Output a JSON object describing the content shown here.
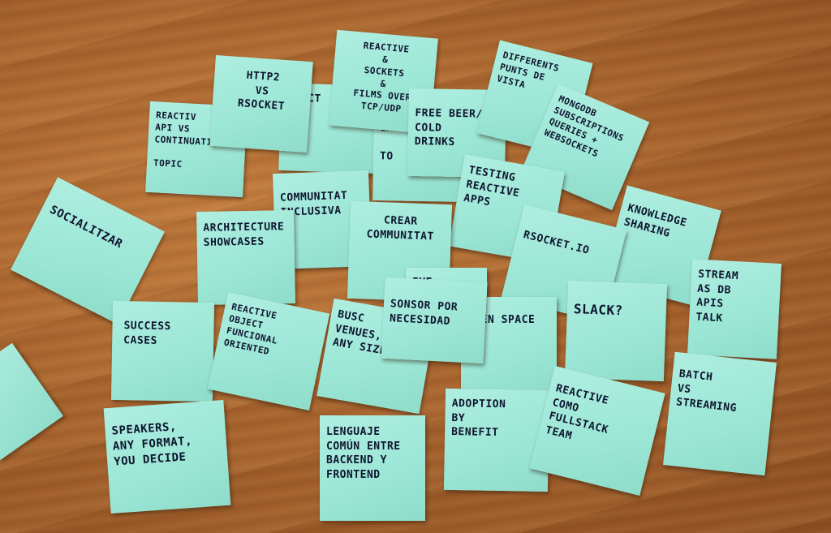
{
  "notes": {
    "socialitzar": "SOCIALITZAR",
    "reactive_api": "REACTIV\nAPI VS\nCONTINUATIONS\n\nTOPIC",
    "http2": "HTTP2\nVS\nRSOCKET",
    "spect": "SPECT",
    "reactive_sockets": "REACTIVE\n&\nSOCKETS\n&\nFILMS OVER\nTCP/UDP",
    "free_beer": "FREE BEER/\nCOLD\nDRINKS",
    "exp_topic": "EXO\n\nTO",
    "different_points": "DIFFERENTS\nPUNTS DE\nVISTA",
    "mongodb": "MONGODB\nSUBSCRIPTIONS\nQUERIES +\nWEBSOCKETS",
    "testing_reactive": "TESTING\nREACTIVE\nAPPS",
    "comunitat_inclusiva": "COMMUNITAT\nINCLUSIVA",
    "crear_comunitat": "CREAR\nCOMMUNITAT",
    "architecture": "ARCHITECTURE\nSHOWCASES",
    "knowledge": "KNOWLEDGE\nSHARING",
    "rsocket_io": "RSOCKET.IO",
    "stream_db": "STREAM\nAS DB\nAPIS\nTALK",
    "success": "SUCCESS\nCASES",
    "reactive_oo": "REACTIVE\nOBJECT     FUNCIONAL\nORIENTED",
    "ive": "IVE",
    "slack": "SLACK?",
    "busca_venues": "BUSC\nVENUES,\nANY SIZE",
    "sonsor": "SONSOR POR\nNECESIDAD",
    "open_space": "OPEN SPACE",
    "batch": "BATCH\nVS\nSTREAMING",
    "speakers": "SPEAKERS,\nANY FORMAT,\nYOU DECIDE",
    "lenguaje": "LENGUAJE\nCOMÚN ENTRE\nBACKEND Y\nFRONTEND",
    "adoption": "ADOPTION\nBY\nBENEFIT",
    "reactive_fullstack": "REACTIVE\nCOMO\nFULLSTACK\nTEAM"
  }
}
